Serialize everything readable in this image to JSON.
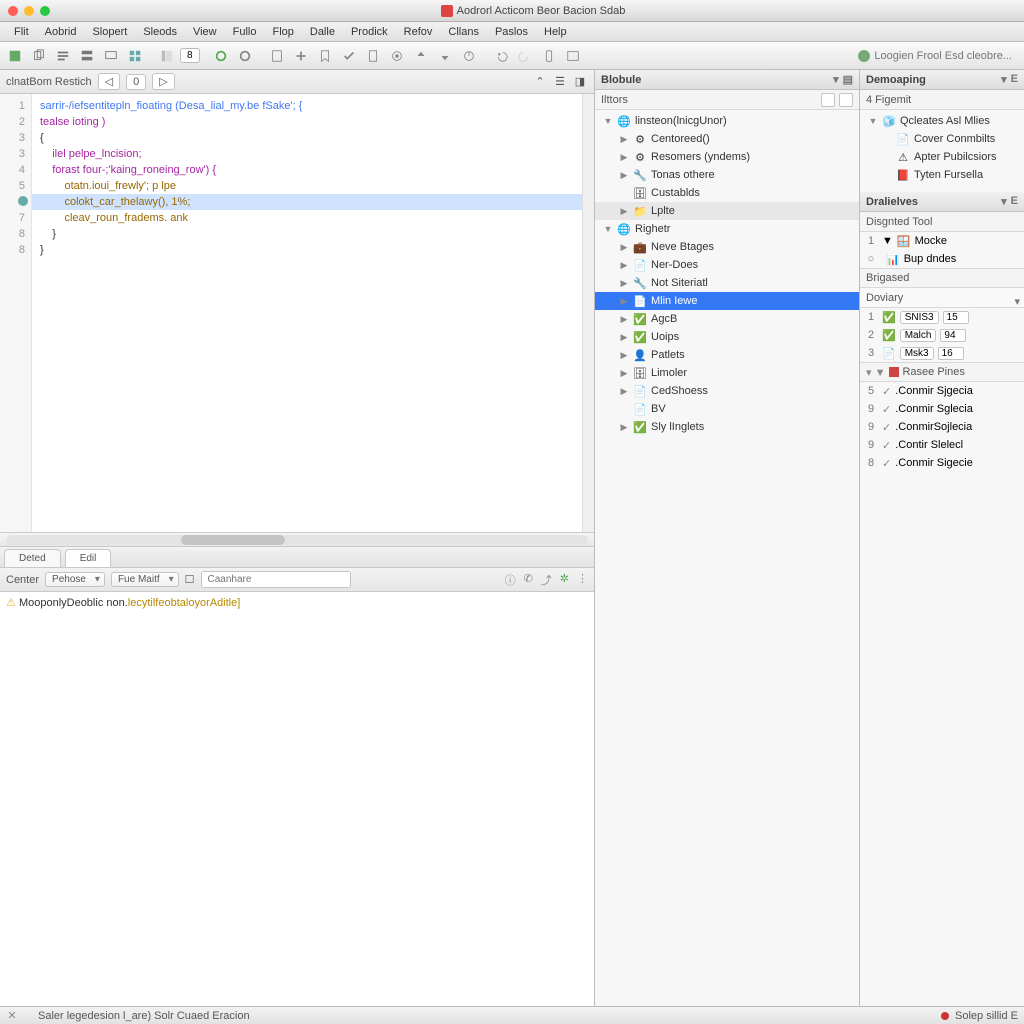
{
  "window": {
    "title": "Aodrorl Acticom Beor Bacion Sdab"
  },
  "menu": [
    "Flit",
    "Aobrid",
    "Slopert",
    "Sleods",
    "View",
    "Fullo",
    "Flop",
    "Dalle",
    "Prodick",
    "Refov",
    "Cllans",
    "Paslos",
    "Help"
  ],
  "toolbar": {
    "spinner_value": "8",
    "right_label": "Loogien Frool Esd cleobre..."
  },
  "breadcrumb": {
    "label": "clnatBom Restich",
    "segments": [
      "◁",
      "0",
      "▷"
    ]
  },
  "editor": {
    "gutter": [
      "1",
      "2",
      "3",
      "3",
      "4",
      "5",
      "6",
      "7",
      "8",
      "8"
    ],
    "highlight_line": 6,
    "lines": [
      {
        "t": "sarrir-/iefsentitepln_fioating (Desa_lial_my.be fSake'; {",
        "cls": "fn"
      },
      {
        "t": "tealse ioting )",
        "cls": "kw"
      },
      {
        "t": "{",
        "cls": ""
      },
      {
        "t": "    ilel pelpe_lncision;",
        "cls": "kw"
      },
      {
        "t": "    forast four-;'kaing_roneing_row') {",
        "cls": "kw"
      },
      {
        "t": "        otatn.ioui_frewly'; p lpe",
        "cls": "id"
      },
      {
        "t": "        colokt_car_thelawy(), 1%;",
        "cls": "id"
      },
      {
        "t": "        cleav_roun_fradems. ank",
        "cls": "id"
      },
      {
        "t": "    }",
        "cls": ""
      },
      {
        "t": "}",
        "cls": ""
      }
    ]
  },
  "tabs": {
    "items": [
      "Deted",
      "Edil"
    ],
    "active": 1
  },
  "console": {
    "label": "Center",
    "select1": "Pehose",
    "select2": "Fue Maitf",
    "search_placeholder": "Caanhare",
    "message_plain": "MooponlyDeoblic non.",
    "message_em": "lecytilfeobtaloyorAditle]"
  },
  "mid_panel": {
    "title": "Blobule",
    "subtitle": "Ilttors",
    "tree": [
      {
        "d": 0,
        "tw": "▼",
        "ic": "globe",
        "lbl": "linsteon(lnicgUnor)",
        "hov": false
      },
      {
        "d": 1,
        "tw": "▶",
        "ic": "gear",
        "lbl": "Centoreed()"
      },
      {
        "d": 1,
        "tw": "▶",
        "ic": "gear",
        "lbl": "Resomers (yndems)"
      },
      {
        "d": 1,
        "tw": "▶",
        "ic": "wrench",
        "lbl": "Tonas othere"
      },
      {
        "d": 1,
        "tw": "",
        "ic": "db",
        "lbl": "Custablds"
      },
      {
        "d": 1,
        "tw": "▶",
        "ic": "folder",
        "lbl": "Lplte",
        "hov": true
      },
      {
        "d": 0,
        "tw": "▼",
        "ic": "globe",
        "lbl": "Righetr"
      },
      {
        "d": 1,
        "tw": "▶",
        "ic": "case",
        "lbl": "Neve Btages"
      },
      {
        "d": 1,
        "tw": "▶",
        "ic": "doc",
        "lbl": "Ner-Does"
      },
      {
        "d": 1,
        "tw": "▶",
        "ic": "wrench",
        "lbl": "Not Siteriatl"
      },
      {
        "d": 1,
        "tw": "▶",
        "ic": "doc",
        "lbl": "Mlin Iewe",
        "sel": true
      },
      {
        "d": 1,
        "tw": "▶",
        "ic": "ok",
        "lbl": "AgcB"
      },
      {
        "d": 1,
        "tw": "▶",
        "ic": "ok",
        "lbl": "Uoips"
      },
      {
        "d": 1,
        "tw": "▶",
        "ic": "user",
        "lbl": "Patlets"
      },
      {
        "d": 1,
        "tw": "▶",
        "ic": "db",
        "lbl": "Limoler"
      },
      {
        "d": 1,
        "tw": "▶",
        "ic": "doc",
        "lbl": "CedShoess"
      },
      {
        "d": 1,
        "tw": "",
        "ic": "doc",
        "lbl": "BV"
      },
      {
        "d": 1,
        "tw": "▶",
        "ic": "ok",
        "lbl": "Sly lInglets"
      }
    ]
  },
  "right_panels": {
    "debug_title": "Demoaping",
    "debug_sub": "4 Figemit",
    "debug_tree": [
      {
        "d": 0,
        "tw": "▼",
        "ic": "cube",
        "lbl": "Qcleates Asl Mlies"
      },
      {
        "d": 1,
        "tw": "",
        "ic": "doc",
        "lbl": "Cover Conmbilts"
      },
      {
        "d": 1,
        "tw": "",
        "ic": "warn",
        "lbl": "Apter Pubilcsiors"
      },
      {
        "d": 1,
        "tw": "",
        "ic": "doc2",
        "lbl": "Tyten Fursella"
      }
    ],
    "detail_title": "Dralielves",
    "detail_sub": "Disgnted Tool",
    "detail_rows": [
      {
        "k": "1",
        "tw": "▼",
        "ic": "win",
        "lbl": "Mocke"
      },
      {
        "k": "○",
        "tw": "",
        "ic": "chart",
        "lbl": "Bup dndes"
      }
    ],
    "grid_head1": "Brigased",
    "grid_head2": "Doviary",
    "grid_rows": [
      {
        "k": "1",
        "ic": "ok",
        "lbl": "SNIS3",
        "val": "15"
      },
      {
        "k": "2",
        "ic": "ok",
        "lbl": "Malch",
        "val": "94"
      },
      {
        "k": "3",
        "ic": "doc",
        "lbl": "Msk3",
        "val": "16"
      }
    ],
    "list_head": "Rasee Pines",
    "list_rows": [
      {
        "k": "5",
        "lbl": ".Conmir Sjgecia"
      },
      {
        "k": "9",
        "lbl": ".Conmir Sglecia"
      },
      {
        "k": "9",
        "lbl": ".ConmirSojlecia"
      },
      {
        "k": "9",
        "lbl": ".Contir Slelecl"
      },
      {
        "k": "8",
        "lbl": ".Conmir Sigecie"
      }
    ]
  },
  "status": {
    "left": "Saler legedesion l_are) Solr Cuaed Eracion",
    "right": "Solep sillid E"
  }
}
